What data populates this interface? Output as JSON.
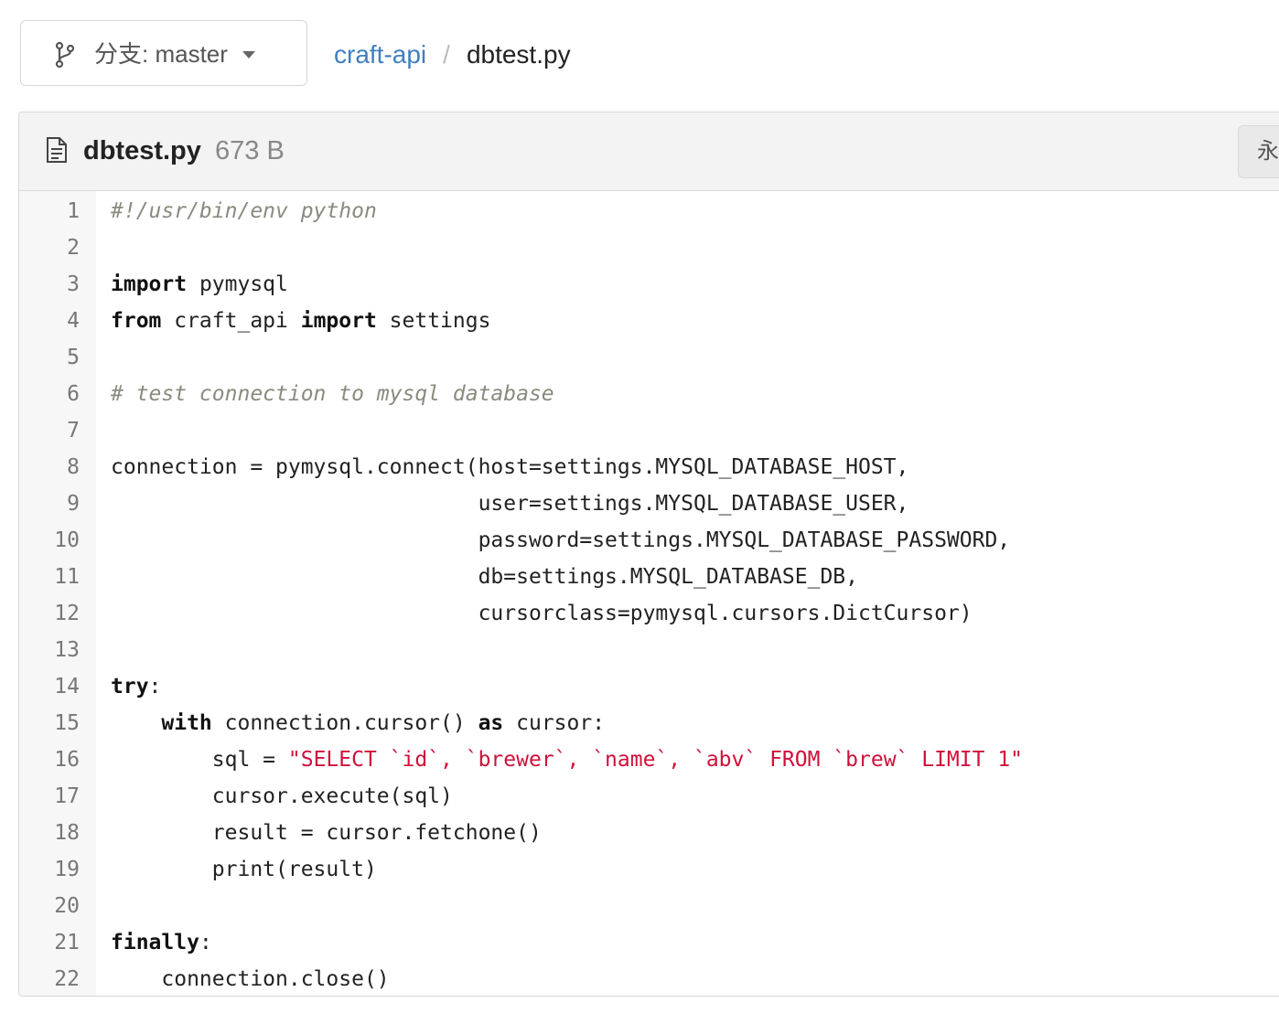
{
  "branch": {
    "label": "分支: master",
    "icon": "git-branch-icon"
  },
  "breadcrumb": {
    "repo": "craft-api",
    "separator": "/",
    "file": "dbtest.py"
  },
  "file": {
    "icon": "file-text-icon",
    "name": "dbtest.py",
    "size": "673 B",
    "permalink_label": "永久链接"
  },
  "code": {
    "language": "python",
    "lines": [
      [
        {
          "t": "#!/usr/bin/env python",
          "c": "comment"
        }
      ],
      [],
      [
        {
          "t": "import",
          "c": "kw"
        },
        {
          "t": " pymysql"
        }
      ],
      [
        {
          "t": "from",
          "c": "kw"
        },
        {
          "t": " craft_api "
        },
        {
          "t": "import",
          "c": "kw"
        },
        {
          "t": " settings"
        }
      ],
      [],
      [
        {
          "t": "# test connection to mysql database",
          "c": "comment"
        }
      ],
      [],
      [
        {
          "t": "connection = pymysql.connect(host=settings.MYSQL_DATABASE_HOST,"
        }
      ],
      [
        {
          "t": "                             user=settings.MYSQL_DATABASE_USER,"
        }
      ],
      [
        {
          "t": "                             password=settings.MYSQL_DATABASE_PASSWORD,"
        }
      ],
      [
        {
          "t": "                             db=settings.MYSQL_DATABASE_DB,"
        }
      ],
      [
        {
          "t": "                             cursorclass=pymysql.cursors.DictCursor)"
        }
      ],
      [],
      [
        {
          "t": "try",
          "c": "kw"
        },
        {
          "t": ":"
        }
      ],
      [
        {
          "t": "    "
        },
        {
          "t": "with",
          "c": "kw"
        },
        {
          "t": " connection.cursor() "
        },
        {
          "t": "as",
          "c": "kw"
        },
        {
          "t": " cursor:"
        }
      ],
      [
        {
          "t": "        sql = "
        },
        {
          "t": "\"SELECT `id`, `brewer`, `name`, `abv` FROM `brew` LIMIT 1\"",
          "c": "str"
        }
      ],
      [
        {
          "t": "        cursor.execute(sql)"
        }
      ],
      [
        {
          "t": "        result = cursor.fetchone()"
        }
      ],
      [
        {
          "t": "        print(result)"
        }
      ],
      [],
      [
        {
          "t": "finally",
          "c": "kw"
        },
        {
          "t": ":"
        }
      ],
      [
        {
          "t": "    connection.close()"
        }
      ]
    ]
  }
}
